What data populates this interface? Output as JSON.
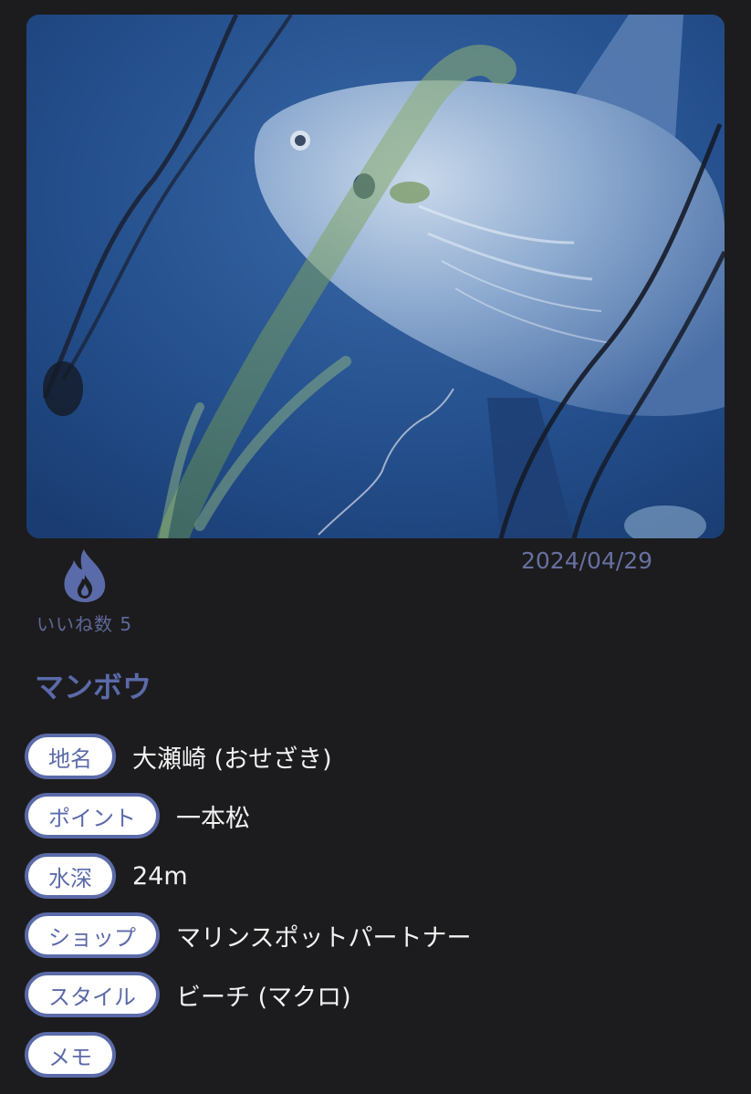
{
  "post": {
    "photo_icon": "ocean-sunfish-photo",
    "like_icon": "flame-icon",
    "like_label": "いいね数 5",
    "date": "2024/04/29",
    "species": "マンボウ"
  },
  "details": [
    {
      "label": "地名",
      "value": "大瀬崎 (おせざき)"
    },
    {
      "label": "ポイント",
      "value": "一本松"
    },
    {
      "label": "水深",
      "value": "24m"
    },
    {
      "label": "ショップ",
      "value": "マリンスポットパートナー"
    },
    {
      "label": "スタイル",
      "value": "ビーチ (マクロ)"
    },
    {
      "label": "メモ",
      "value": ""
    }
  ],
  "colors": {
    "background": "#1c1c1e",
    "accent": "#5b6aa8",
    "pill_fill": "#ffffff",
    "value_text": "#f2f2f2"
  }
}
